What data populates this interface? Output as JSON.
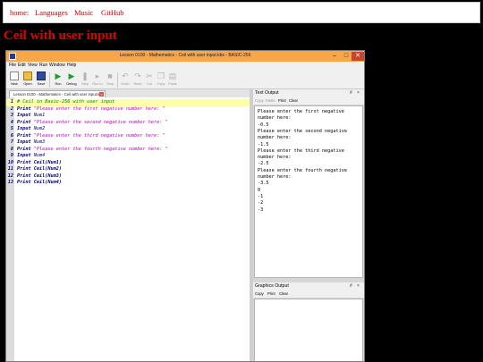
{
  "site": {
    "nav": [
      "home:",
      "Languages",
      "Music",
      "GitHub"
    ],
    "page_title": "Ceil with user input"
  },
  "app": {
    "title": "Lesson 0100 - Mathematics - Ceil with user input.kbs - BASIC-256",
    "menu": [
      "File",
      "Edit",
      "View",
      "Run",
      "Window",
      "Help"
    ],
    "toolbar": [
      {
        "label": "New",
        "icon": "new-file-icon",
        "enabled": true
      },
      {
        "label": "Open",
        "icon": "open-folder-icon",
        "enabled": true
      },
      {
        "label": "Save",
        "icon": "save-disk-icon",
        "enabled": true
      },
      {
        "label": "Run",
        "icon": "run-icon",
        "enabled": true
      },
      {
        "label": "Debug",
        "icon": "debug-icon",
        "enabled": true
      },
      {
        "label": "Step",
        "icon": "step-icon",
        "enabled": false
      },
      {
        "label": "Run to",
        "icon": "run-to-icon",
        "enabled": false
      },
      {
        "label": "Stop",
        "icon": "stop-icon",
        "enabled": false
      },
      {
        "label": "Undo",
        "icon": "undo-icon",
        "enabled": false
      },
      {
        "label": "Redo",
        "icon": "redo-icon",
        "enabled": false
      },
      {
        "label": "Cut",
        "icon": "cut-icon",
        "enabled": false
      },
      {
        "label": "Copy",
        "icon": "copy-icon",
        "enabled": false
      },
      {
        "label": "Paste",
        "icon": "paste-icon",
        "enabled": false
      }
    ],
    "tab_label": "Lesson 0100 - Mathematics - Ceil with user input.kbs",
    "code_lines": [
      {
        "n": "1",
        "kw": "",
        "text": "# Ceil in Basic-256 with user input",
        "type": "cmt"
      },
      {
        "n": "2",
        "kw": "Print",
        "text": "\"Please enter the first negative number here: \"",
        "type": "str"
      },
      {
        "n": "3",
        "kw": "Input",
        "text": "Num1",
        "type": "var"
      },
      {
        "n": "4",
        "kw": "Print",
        "text": "\"Please enter the second negative number here: \"",
        "type": "str"
      },
      {
        "n": "5",
        "kw": "Input",
        "text": "Num2",
        "type": "var"
      },
      {
        "n": "6",
        "kw": "Print",
        "text": "\"Please enter the third negative number here: \"",
        "type": "str"
      },
      {
        "n": "7",
        "kw": "Input",
        "text": "Num3",
        "type": "var"
      },
      {
        "n": "8",
        "kw": "Print",
        "text": "\"Please enter the fourth negative number here: \"",
        "type": "str"
      },
      {
        "n": "9",
        "kw": "Input",
        "text": "Num4",
        "type": "var"
      },
      {
        "n": "10",
        "kw": "Print",
        "text": "Ceil(Num1)",
        "type": "fn"
      },
      {
        "n": "11",
        "kw": "Print",
        "text": "Ceil(Num2)",
        "type": "fn"
      },
      {
        "n": "12",
        "kw": "Print",
        "text": "Ceil(Num3)",
        "type": "fn"
      },
      {
        "n": "13",
        "kw": "Print",
        "text": "Ceil(Num4)",
        "type": "fn"
      }
    ],
    "text_output": {
      "title": "Text Output",
      "tools": [
        "Copy",
        "Paste",
        "Print",
        "Clear"
      ],
      "lines": [
        "Please enter the first negative",
        "number here:",
        "-0.5",
        "Please enter the second negative",
        "number here:",
        "-1.5",
        "Please enter the third negative",
        "number here:",
        "-2.5",
        "Please enter the fourth negative",
        "number here:",
        "-3.5",
        "0",
        "-1",
        "-2",
        "-3"
      ]
    },
    "graphics_output": {
      "title": "Graphics Output",
      "tools": [
        "Copy",
        "Print",
        "Clear"
      ]
    },
    "panel_icons": {
      "float": "#",
      "close": "×"
    },
    "window_buttons": {
      "minimize": "–",
      "maximize": "□",
      "close": "✕"
    }
  }
}
